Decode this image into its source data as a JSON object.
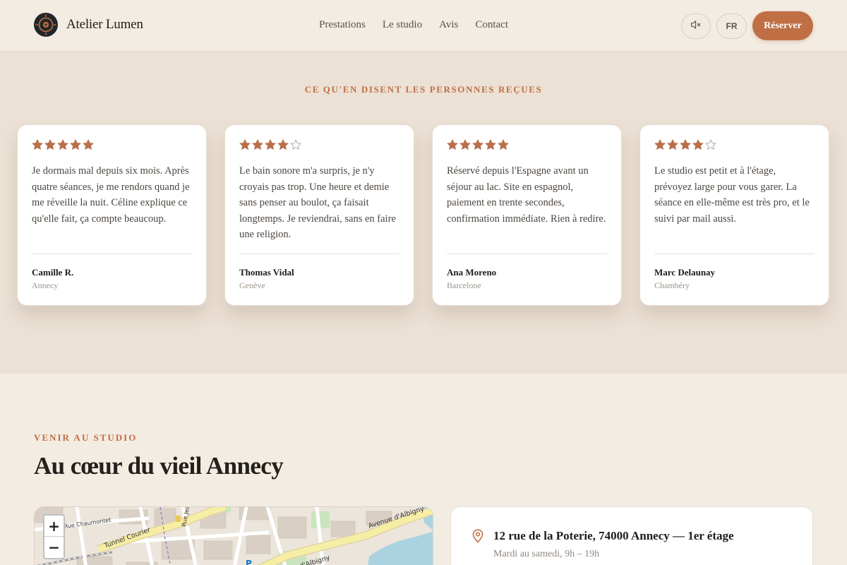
{
  "header": {
    "brand_name": "Atelier Lumen",
    "nav": [
      "Prestations",
      "Le studio",
      "Avis",
      "Contact"
    ],
    "mute_icon": "speaker-muted-icon",
    "lang_label": "FR",
    "reserve_label": "Réserver"
  },
  "testimonials": {
    "eyebrow": "CE QU'EN DISENT LES PERSONNES REÇUES",
    "items": [
      {
        "rating": 5,
        "quote": "Je dormais mal depuis six mois. Après quatre séances, je me rendors quand je me réveille la nuit. Céline explique ce qu'elle fait, ça compte beaucoup.",
        "author": "Camille R.",
        "city": "Annecy"
      },
      {
        "rating": 4,
        "quote": "Le bain sonore m'a surpris, je n'y croyais pas trop. Une heure et demie sans penser au boulot, ça faisait longtemps. Je reviendrai, sans en faire une religion.",
        "author": "Thomas Vidal",
        "city": "Genève"
      },
      {
        "rating": 5,
        "quote": "Réservé depuis l'Espagne avant un séjour au lac. Site en espagnol, paiement en trente secondes, confirmation immédiate. Rien à redire.",
        "author": "Ana Moreno",
        "city": "Barcelone"
      },
      {
        "rating": 4,
        "quote": "Le studio est petit et à l'étage, prévoyez large pour vous garer. La séance en elle-même est très pro, et le suivi par mail aussi.",
        "author": "Marc Delaunay",
        "city": "Chambéry"
      }
    ],
    "star_color": "#b8704a"
  },
  "location": {
    "eyebrow": "VENIR AU STUDIO",
    "title": "Au cœur du vieil Annecy",
    "map": {
      "zoom_in": "+",
      "zoom_out": "−",
      "labels": [
        "Tunnel Courier",
        "Avenue d'Albigny",
        "Avenue d'Albigny",
        "Rue Jean Jaurès",
        "Rue Chaumontet",
        "P"
      ]
    },
    "address": "12 rue de la Poterie, 74000 Annecy — 1er étage",
    "hours": "Mardi au samedi, 9h – 19h",
    "pin_icon": "map-pin-icon"
  }
}
